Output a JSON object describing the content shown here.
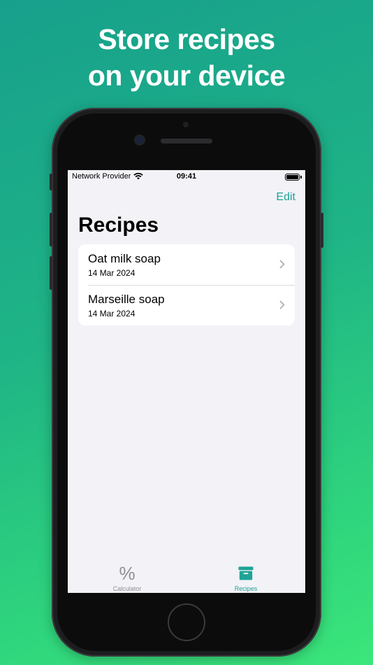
{
  "headline": {
    "line1": "Store recipes",
    "line2": "on your device"
  },
  "status_bar": {
    "carrier": "Network Provider",
    "time": "09:41"
  },
  "nav": {
    "edit_label": "Edit",
    "title": "Recipes"
  },
  "recipes": [
    {
      "name": "Oat milk soap",
      "date": "14 Mar 2024"
    },
    {
      "name": "Marseille soap",
      "date": "14 Mar 2024"
    }
  ],
  "tabs": [
    {
      "label": "Calculator",
      "icon": "percent-icon",
      "glyph": "%",
      "active": false
    },
    {
      "label": "Recipes",
      "icon": "archive-box-icon",
      "active": true
    }
  ],
  "colors": {
    "accent": "#1fa396",
    "inactive_tab": "#8e8e93",
    "background_gradient_start": "#17a08c",
    "background_gradient_end": "#3be67a"
  }
}
